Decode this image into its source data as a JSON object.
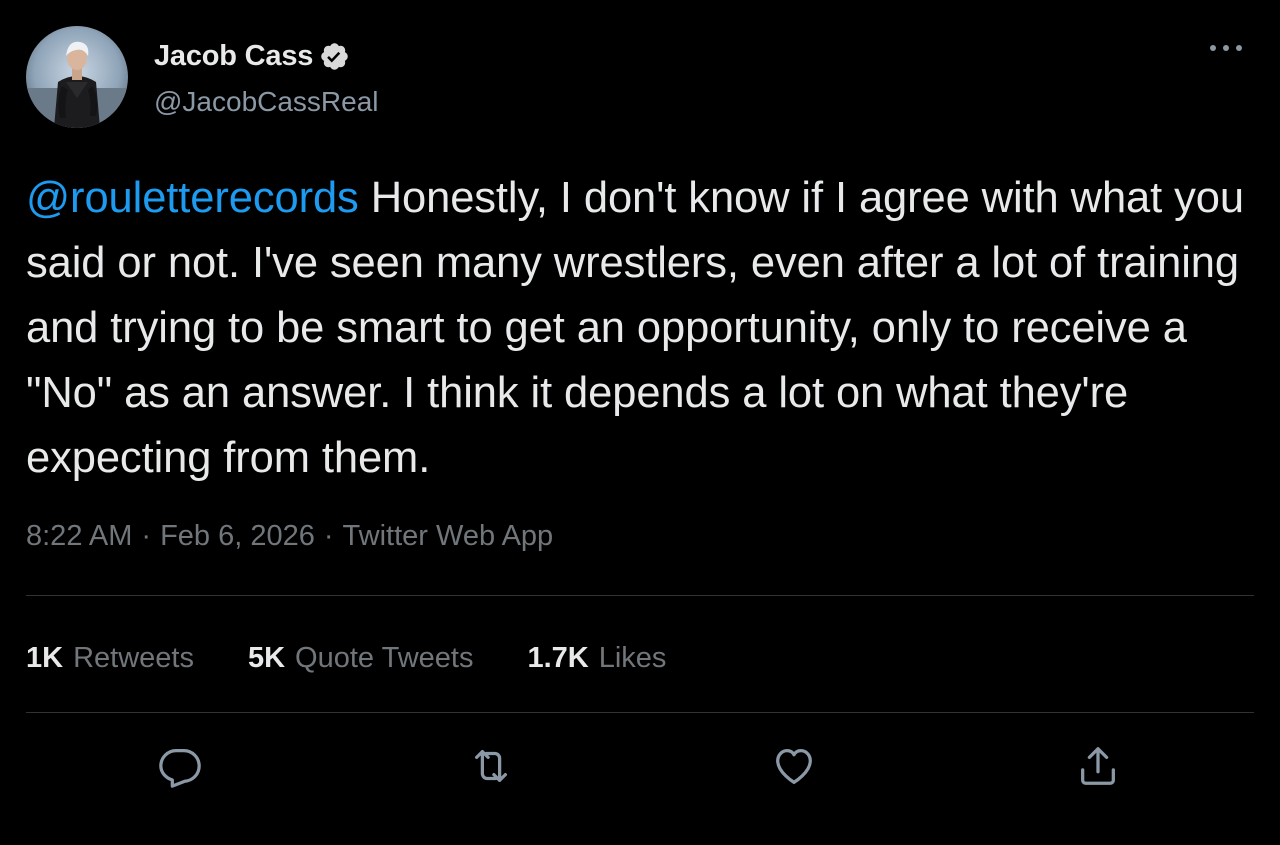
{
  "author": {
    "display_name": "Jacob Cass",
    "handle": "@JacobCassReal",
    "verified": true
  },
  "tweet": {
    "mention": "@rouletterecords",
    "text": " Honestly, I don't know if I agree with what you said or not. I've seen many wrestlers, even after a lot of training and trying to be smart to get an opportunity, only to receive a \"No\" as an answer. I think it depends a lot on what they're expecting from them."
  },
  "meta": {
    "time": "8:22 AM",
    "date": "Feb 6, 2026",
    "source": "Twitter Web App",
    "separator": "·"
  },
  "stats": {
    "retweets_count": "1K",
    "retweets_label": "Retweets",
    "quotes_count": "5K",
    "quotes_label": "Quote Tweets",
    "likes_count": "1.7K",
    "likes_label": "Likes"
  },
  "icons": {
    "more": "more-horizontal-icon",
    "verified": "verified-badge-icon",
    "reply": "reply-icon",
    "retweet": "retweet-icon",
    "like": "heart-icon",
    "share": "share-icon"
  },
  "colors": {
    "background": "#000000",
    "text": "#e7e9ea",
    "secondary_text": "#71767b",
    "handle_text": "#8b98a5",
    "link": "#1d9bf0",
    "divider": "#2f3336",
    "icon": "#8b98a5"
  }
}
